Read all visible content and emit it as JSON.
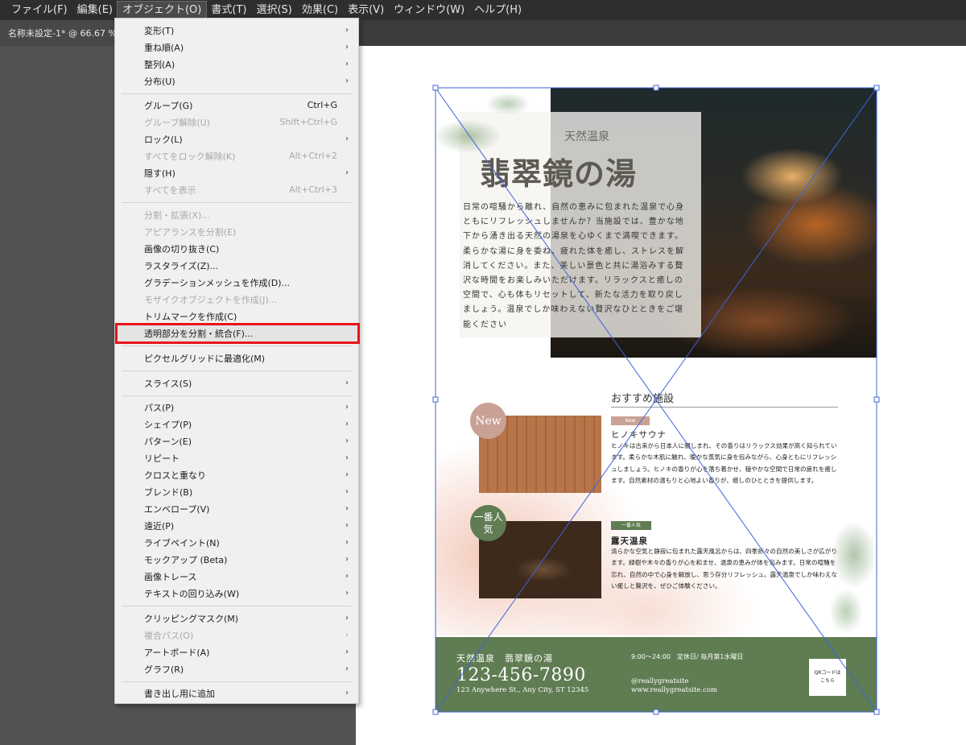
{
  "menubar": {
    "items": [
      {
        "label": "ファイル(F)"
      },
      {
        "label": "編集(E)"
      },
      {
        "label": "オブジェクト(O)"
      },
      {
        "label": "書式(T)"
      },
      {
        "label": "選択(S)"
      },
      {
        "label": "効果(C)"
      },
      {
        "label": "表示(V)"
      },
      {
        "label": "ウィンドウ(W)"
      },
      {
        "label": "ヘルプ(H)"
      }
    ],
    "active_index": 2
  },
  "document_tab": {
    "label": "名称未設定-1* @ 66.67 %"
  },
  "object_menu": {
    "items": [
      {
        "label": "変形(T)",
        "shortcut": "",
        "submenu": true,
        "enabled": true
      },
      {
        "label": "重ね順(A)",
        "shortcut": "",
        "submenu": true,
        "enabled": true
      },
      {
        "label": "整列(A)",
        "shortcut": "",
        "submenu": true,
        "enabled": true
      },
      {
        "label": "分布(U)",
        "shortcut": "",
        "submenu": true,
        "enabled": true
      },
      {
        "label": "グループ(G)",
        "shortcut": "Ctrl+G",
        "submenu": false,
        "enabled": true
      },
      {
        "label": "グループ解除(U)",
        "shortcut": "Shift+Ctrl+G",
        "submenu": false,
        "enabled": false
      },
      {
        "label": "ロック(L)",
        "shortcut": "",
        "submenu": true,
        "enabled": true
      },
      {
        "label": "すべてをロック解除(K)",
        "shortcut": "Alt+Ctrl+2",
        "submenu": false,
        "enabled": false
      },
      {
        "label": "隠す(H)",
        "shortcut": "",
        "submenu": true,
        "enabled": true
      },
      {
        "label": "すべてを表示",
        "shortcut": "Alt+Ctrl+3",
        "submenu": false,
        "enabled": false
      },
      {
        "label": "分割・拡張(X)...",
        "shortcut": "",
        "submenu": false,
        "enabled": false
      },
      {
        "label": "アピアランスを分割(E)",
        "shortcut": "",
        "submenu": false,
        "enabled": false
      },
      {
        "label": "画像の切り抜き(C)",
        "shortcut": "",
        "submenu": false,
        "enabled": true
      },
      {
        "label": "ラスタライズ(Z)...",
        "shortcut": "",
        "submenu": false,
        "enabled": true
      },
      {
        "label": "グラデーションメッシュを作成(D)...",
        "shortcut": "",
        "submenu": false,
        "enabled": true
      },
      {
        "label": "モザイクオブジェクトを作成(J)...",
        "shortcut": "",
        "submenu": false,
        "enabled": false
      },
      {
        "label": "トリムマークを作成(C)",
        "shortcut": "",
        "submenu": false,
        "enabled": true
      },
      {
        "label": "透明部分を分割・統合(F)...",
        "shortcut": "",
        "submenu": false,
        "enabled": true,
        "highlighted": true
      },
      {
        "label": "ピクセルグリッドに最適化(M)",
        "shortcut": "",
        "submenu": false,
        "enabled": true
      },
      {
        "label": "スライス(S)",
        "shortcut": "",
        "submenu": true,
        "enabled": true
      },
      {
        "label": "パス(P)",
        "shortcut": "",
        "submenu": true,
        "enabled": true
      },
      {
        "label": "シェイプ(P)",
        "shortcut": "",
        "submenu": true,
        "enabled": true
      },
      {
        "label": "パターン(E)",
        "shortcut": "",
        "submenu": true,
        "enabled": true
      },
      {
        "label": "リピート",
        "shortcut": "",
        "submenu": true,
        "enabled": true
      },
      {
        "label": "クロスと重なり",
        "shortcut": "",
        "submenu": true,
        "enabled": true
      },
      {
        "label": "ブレンド(B)",
        "shortcut": "",
        "submenu": true,
        "enabled": true
      },
      {
        "label": "エンベロープ(V)",
        "shortcut": "",
        "submenu": true,
        "enabled": true
      },
      {
        "label": "遠近(P)",
        "shortcut": "",
        "submenu": true,
        "enabled": true
      },
      {
        "label": "ライブペイント(N)",
        "shortcut": "",
        "submenu": true,
        "enabled": true
      },
      {
        "label": "モックアップ (Beta)",
        "shortcut": "",
        "submenu": true,
        "enabled": true
      },
      {
        "label": "画像トレース",
        "shortcut": "",
        "submenu": true,
        "enabled": true
      },
      {
        "label": "テキストの回り込み(W)",
        "shortcut": "",
        "submenu": true,
        "enabled": true
      },
      {
        "label": "クリッピングマスク(M)",
        "shortcut": "",
        "submenu": true,
        "enabled": true
      },
      {
        "label": "複合パス(O)",
        "shortcut": "",
        "submenu": true,
        "enabled": false
      },
      {
        "label": "アートボード(A)",
        "shortcut": "",
        "submenu": true,
        "enabled": true
      },
      {
        "label": "グラフ(R)",
        "shortcut": "",
        "submenu": true,
        "enabled": true
      },
      {
        "label": "書き出し用に追加",
        "shortcut": "",
        "submenu": true,
        "enabled": true
      }
    ]
  },
  "flyer": {
    "subtitle": "天然温泉",
    "title": "翡翠鏡の湯",
    "intro": "日常の喧騒から離れ、自然の恵みに包まれた温泉で心身ともにリフレッシュしませんか？当施設では、豊かな地下から湧き出る天然の湯泉を心ゆくまで満喫できます。柔らかな湯に身を委ね、疲れた体を癒し、ストレスを解消してください。また、美しい景色と共に湯浴みする贅沢な時間をお楽しみいただけます。リラックスと癒しの空間で、心も体もリセットして、新たな活力を取り戻しましょう。温泉でしか味わえない贅沢なひとときをご堪能ください",
    "recommend_title": "おすすめ施設",
    "items": [
      {
        "badge": "New",
        "tag": "New",
        "name": "ヒノキサウナ",
        "desc": "ヒノキは古来から日本人に親しまれ、その香りはリラックス効果が高く知られています。柔らかな木肌に触れ、暖かな蒸気に身を包みながら、心身ともにリフレッシュしましょう。ヒノキの香りが心を落ち着かせ、穏やかな空間で日常の疲れを癒します。自然素材の温もりと心地よい香りが、癒しのひとときを提供します。"
      },
      {
        "badge": "一番人気",
        "tag": "一番人気",
        "name": "露天温泉",
        "desc": "清らかな空気と静寂に包まれた露天風呂からは、四季折々の自然の美しさが広がります。緑樹や木々の香りが心を和ませ、温泉の恵みが体を包みます。日常の喧騒を忘れ、自然の中で心身を解放し、思う存分リフレッシュ。露天温泉でしか味わえない癒しと贅沢を、ぜひご体験ください。"
      }
    ],
    "footer": {
      "name": "天然温泉　翡翠鏡の湯",
      "tel": "123-456-7890",
      "address": "123 Anywhere St., Any City, ST 12345",
      "hours": "9:00〜24:00　定休日/ 毎月第1水曜日",
      "sns": "@reallygreatsite",
      "web": "www.reallygreatsite.com",
      "qr": "QRコードはこちら"
    }
  },
  "colors": {
    "accent_green": "#5f7c52",
    "accent_pink": "#c9a195",
    "highlight_red": "#e8141a",
    "selection_blue": "#3d64d8"
  }
}
